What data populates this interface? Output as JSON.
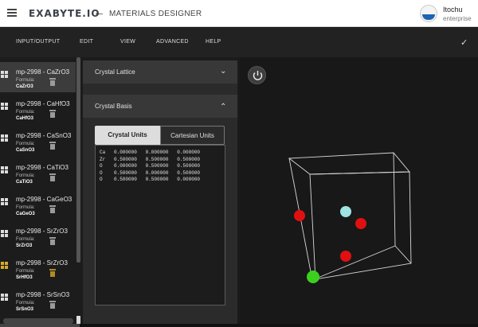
{
  "header": {
    "logo_text": "EXABYTE.IO",
    "title": "MATERIALS DESIGNER",
    "user_name": "Itochu",
    "user_role": "enterprise"
  },
  "menu": {
    "items": [
      "INPUT/OUTPUT",
      "EDIT",
      "VIEW",
      "ADVANCED",
      "HELP"
    ]
  },
  "materials": {
    "formula_label": "Formula:",
    "items": [
      {
        "title": "mp-2998 - CaZrO3",
        "formula": "CaZrO3",
        "selected": true,
        "icon_color": "#dddddd"
      },
      {
        "title": "mp-2998 - CaHfO3",
        "formula": "CaHfO3",
        "selected": false,
        "icon_color": "#dddddd"
      },
      {
        "title": "mp-2998 - CaSnO3",
        "formula": "CaSnO3",
        "selected": false,
        "icon_color": "#dddddd"
      },
      {
        "title": "mp-2998 - CaTiO3",
        "formula": "CaTiO3",
        "selected": false,
        "icon_color": "#dddddd"
      },
      {
        "title": "mp-2998 - CaGeO3",
        "formula": "CaGeO3",
        "selected": false,
        "icon_color": "#dddddd"
      },
      {
        "title": "mp-2998 - SrZrO3",
        "formula": "SrZrO3",
        "selected": false,
        "icon_color": "#dddddd"
      },
      {
        "title": "mp-2998 - SrZrO3",
        "formula": "SrHfO3",
        "selected": false,
        "icon_color": "#d8aa2a"
      },
      {
        "title": "mp-2998 - SrSnO3",
        "formula": "SrSnO3",
        "selected": false,
        "icon_color": "#dddddd"
      }
    ]
  },
  "editor": {
    "lattice_title": "Crystal Lattice",
    "basis_title": "Crystal Basis",
    "tab_crystal": "Crystal Units",
    "tab_cartesian": "Cartesian Units",
    "basis_lines": [
      "Ca   0.000000   0.000000   0.000000",
      "Zr   0.500000   0.500000   0.500000",
      "O    0.000000   0.500000   0.500000",
      "O    0.500000   0.000000   0.500000",
      "O    0.500000   0.500000   0.000000"
    ]
  },
  "viewer": {
    "atom_colors": {
      "Ca": "#3ccf20",
      "Zr": "#9fe3e3",
      "O": "#e01010"
    },
    "cell_color": "#d8d8d8"
  }
}
